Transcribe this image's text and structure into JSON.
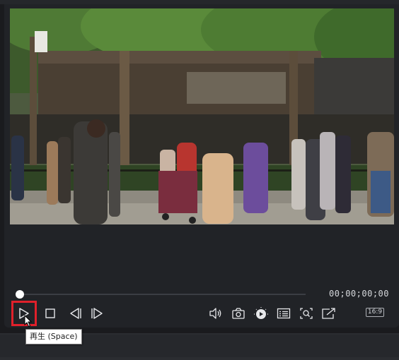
{
  "player": {
    "timecode": "00;00;00;00",
    "progress": 0,
    "aspect_ratio": "16:9"
  },
  "controls": [
    {
      "name": "play-button",
      "icon": "play-icon"
    },
    {
      "name": "stop-button",
      "icon": "stop-icon"
    },
    {
      "name": "previous-frame-button",
      "icon": "previous-frame-icon"
    },
    {
      "name": "next-frame-button",
      "icon": "next-frame-icon"
    },
    {
      "name": "volume-button",
      "icon": "speaker-icon"
    },
    {
      "name": "snapshot-button",
      "icon": "camera-icon"
    },
    {
      "name": "playback-speed-button",
      "icon": "playback-speed-icon"
    },
    {
      "name": "subtitles-button",
      "icon": "subtitles-icon"
    },
    {
      "name": "zoom-button",
      "icon": "zoom-icon"
    },
    {
      "name": "external-preview-button",
      "icon": "external-window-icon"
    }
  ],
  "tooltip": {
    "text": "再生 (Space)"
  },
  "colors": {
    "highlight": "#e0202b",
    "panel": "#212327",
    "background": "#1a1b1e"
  }
}
